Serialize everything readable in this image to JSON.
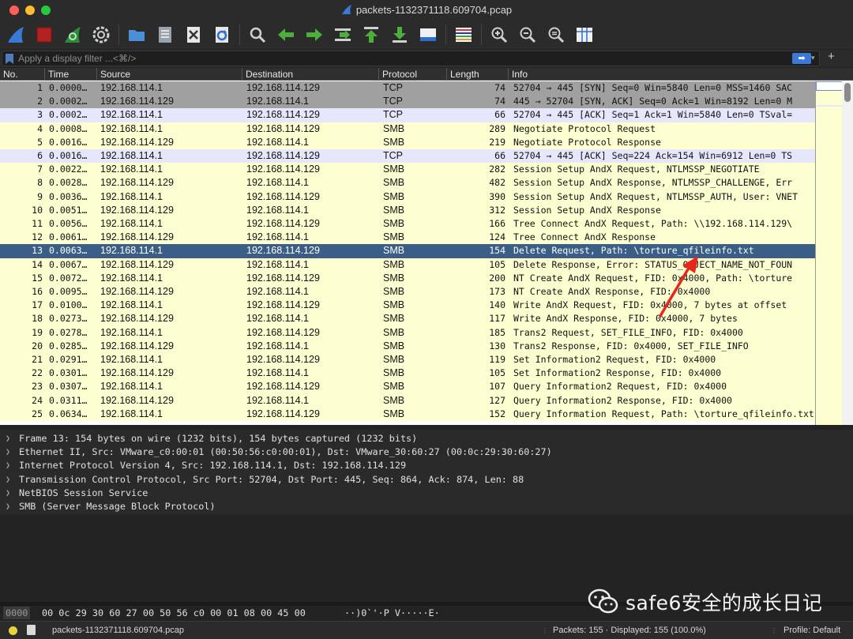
{
  "window": {
    "title": "packets-1132371118.609704.pcap"
  },
  "toolbar": {
    "icons": [
      "shark-fin-start-icon",
      "stop-capture-icon",
      "restart-capture-icon",
      "capture-options-icon",
      "open-file-icon",
      "save-file-icon",
      "close-file-icon",
      "reload-file-icon",
      "find-packet-icon",
      "go-back-icon",
      "go-forward-icon",
      "go-to-packet-icon",
      "first-packet-icon",
      "last-packet-icon",
      "autoscroll-icon",
      "colorize-icon",
      "zoom-in-icon",
      "zoom-out-icon",
      "zoom-normal-icon",
      "resize-columns-icon"
    ]
  },
  "filter": {
    "placeholder": "Apply a display filter ...<⌘/>",
    "plus": "+"
  },
  "columns": {
    "no": "No.",
    "time": "Time",
    "source": "Source",
    "destination": "Destination",
    "protocol": "Protocol",
    "length": "Length",
    "info": "Info"
  },
  "packets": [
    {
      "no": "1",
      "time": "0.0000…",
      "src": "192.168.114.1",
      "dst": "192.168.114.129",
      "proto": "TCP",
      "len": "74",
      "info": "52704 → 445 [SYN] Seq=0 Win=5840 Len=0 MSS=1460 SAC",
      "style": "tcp-hs"
    },
    {
      "no": "2",
      "time": "0.0002…",
      "src": "192.168.114.129",
      "dst": "192.168.114.1",
      "proto": "TCP",
      "len": "74",
      "info": "445 → 52704 [SYN, ACK] Seq=0 Ack=1 Win=8192 Len=0 M",
      "style": "tcp-hs"
    },
    {
      "no": "3",
      "time": "0.0002…",
      "src": "192.168.114.1",
      "dst": "192.168.114.129",
      "proto": "TCP",
      "len": "66",
      "info": "52704 → 445 [ACK] Seq=1 Ack=1 Win=5840 Len=0 TSval=",
      "style": "tcp"
    },
    {
      "no": "4",
      "time": "0.0008…",
      "src": "192.168.114.1",
      "dst": "192.168.114.129",
      "proto": "SMB",
      "len": "289",
      "info": "Negotiate Protocol Request",
      "style": "smb"
    },
    {
      "no": "5",
      "time": "0.0016…",
      "src": "192.168.114.129",
      "dst": "192.168.114.1",
      "proto": "SMB",
      "len": "219",
      "info": "Negotiate Protocol Response",
      "style": "smb"
    },
    {
      "no": "6",
      "time": "0.0016…",
      "src": "192.168.114.1",
      "dst": "192.168.114.129",
      "proto": "TCP",
      "len": "66",
      "info": "52704 → 445 [ACK] Seq=224 Ack=154 Win=6912 Len=0 TS",
      "style": "tcp"
    },
    {
      "no": "7",
      "time": "0.0022…",
      "src": "192.168.114.1",
      "dst": "192.168.114.129",
      "proto": "SMB",
      "len": "282",
      "info": "Session Setup AndX Request, NTLMSSP_NEGOTIATE",
      "style": "smb"
    },
    {
      "no": "8",
      "time": "0.0028…",
      "src": "192.168.114.129",
      "dst": "192.168.114.1",
      "proto": "SMB",
      "len": "482",
      "info": "Session Setup AndX Response, NTLMSSP_CHALLENGE, Err",
      "style": "smb"
    },
    {
      "no": "9",
      "time": "0.0036…",
      "src": "192.168.114.1",
      "dst": "192.168.114.129",
      "proto": "SMB",
      "len": "390",
      "info": "Session Setup AndX Request, NTLMSSP_AUTH, User: VNET",
      "style": "smb"
    },
    {
      "no": "10",
      "time": "0.0051…",
      "src": "192.168.114.129",
      "dst": "192.168.114.1",
      "proto": "SMB",
      "len": "312",
      "info": "Session Setup AndX Response",
      "style": "smb"
    },
    {
      "no": "11",
      "time": "0.0056…",
      "src": "192.168.114.1",
      "dst": "192.168.114.129",
      "proto": "SMB",
      "len": "166",
      "info": "Tree Connect AndX Request, Path: \\\\192.168.114.129\\",
      "style": "smb"
    },
    {
      "no": "12",
      "time": "0.0061…",
      "src": "192.168.114.129",
      "dst": "192.168.114.1",
      "proto": "SMB",
      "len": "124",
      "info": "Tree Connect AndX Response",
      "style": "smb"
    },
    {
      "no": "13",
      "time": "0.0063…",
      "src": "192.168.114.1",
      "dst": "192.168.114.129",
      "proto": "SMB",
      "len": "154",
      "info": "Delete Request, Path: \\torture_qfileinfo.txt",
      "style": "sel"
    },
    {
      "no": "14",
      "time": "0.0067…",
      "src": "192.168.114.129",
      "dst": "192.168.114.1",
      "proto": "SMB",
      "len": "105",
      "info": "Delete Response, Error: STATUS_OBJECT_NAME_NOT_FOUN",
      "style": "smb"
    },
    {
      "no": "15",
      "time": "0.0072…",
      "src": "192.168.114.1",
      "dst": "192.168.114.129",
      "proto": "SMB",
      "len": "200",
      "info": "NT Create AndX Request, FID: 0x4000, Path: \\torture",
      "style": "smb"
    },
    {
      "no": "16",
      "time": "0.0095…",
      "src": "192.168.114.129",
      "dst": "192.168.114.1",
      "proto": "SMB",
      "len": "173",
      "info": "NT Create AndX Response, FID: 0x4000",
      "style": "smb"
    },
    {
      "no": "17",
      "time": "0.0100…",
      "src": "192.168.114.1",
      "dst": "192.168.114.129",
      "proto": "SMB",
      "len": "140",
      "info": "Write AndX Request, FID: 0x4000, 7 bytes at offset",
      "style": "smb"
    },
    {
      "no": "18",
      "time": "0.0273…",
      "src": "192.168.114.129",
      "dst": "192.168.114.1",
      "proto": "SMB",
      "len": "117",
      "info": "Write AndX Response, FID: 0x4000, 7 bytes",
      "style": "smb"
    },
    {
      "no": "19",
      "time": "0.0278…",
      "src": "192.168.114.1",
      "dst": "192.168.114.129",
      "proto": "SMB",
      "len": "185",
      "info": "Trans2 Request, SET_FILE_INFO, FID: 0x4000",
      "style": "smb"
    },
    {
      "no": "20",
      "time": "0.0285…",
      "src": "192.168.114.129",
      "dst": "192.168.114.1",
      "proto": "SMB",
      "len": "130",
      "info": "Trans2 Response, FID: 0x4000, SET_FILE_INFO",
      "style": "smb"
    },
    {
      "no": "21",
      "time": "0.0291…",
      "src": "192.168.114.1",
      "dst": "192.168.114.129",
      "proto": "SMB",
      "len": "119",
      "info": "Set Information2 Request, FID: 0x4000",
      "style": "smb"
    },
    {
      "no": "22",
      "time": "0.0301…",
      "src": "192.168.114.129",
      "dst": "192.168.114.1",
      "proto": "SMB",
      "len": "105",
      "info": "Set Information2 Response, FID: 0x4000",
      "style": "smb"
    },
    {
      "no": "23",
      "time": "0.0307…",
      "src": "192.168.114.1",
      "dst": "192.168.114.129",
      "proto": "SMB",
      "len": "107",
      "info": "Query Information2 Request, FID: 0x4000",
      "style": "smb"
    },
    {
      "no": "24",
      "time": "0.0311…",
      "src": "192.168.114.129",
      "dst": "192.168.114.1",
      "proto": "SMB",
      "len": "127",
      "info": "Query Information2 Response, FID: 0x4000",
      "style": "smb"
    },
    {
      "no": "25",
      "time": "0.0634…",
      "src": "192.168.114.1",
      "dst": "192.168.114.129",
      "proto": "SMB",
      "len": "152",
      "info": "Query Information Request, Path: \\torture_qfileinfo.txt",
      "style": "smb"
    }
  ],
  "details": [
    "Frame 13: 154 bytes on wire (1232 bits), 154 bytes captured (1232 bits)",
    "Ethernet II, Src: VMware_c0:00:01 (00:50:56:c0:00:01), Dst: VMware_30:60:27 (00:0c:29:30:60:27)",
    "Internet Protocol Version 4, Src: 192.168.114.1, Dst: 192.168.114.129",
    "Transmission Control Protocol, Src Port: 52704, Dst Port: 445, Seq: 864, Ack: 874, Len: 88",
    "NetBIOS Session Service",
    "SMB (Server Message Block Protocol)"
  ],
  "bytes": {
    "offset": "0000",
    "hex": "00 0c 29 30 60 27 00 50  56 c0 00 01 08 00 45 00",
    "ascii": "··)0`'·P V·····E·"
  },
  "status": {
    "file": "packets-1132371118.609704.pcap",
    "packets": "Packets: 155 · Displayed: 155 (100.0%)",
    "profile": "Profile: Default"
  },
  "watermark": {
    "text": "safe6安全的成长日记",
    "icon": "wechat-icon"
  },
  "colors": {
    "tcp_handshake": "#a0a0a0",
    "tcp": "#e7e6ff",
    "smb": "#feffd0",
    "selected": "#3b5e86",
    "annotation": "#e8261c"
  }
}
